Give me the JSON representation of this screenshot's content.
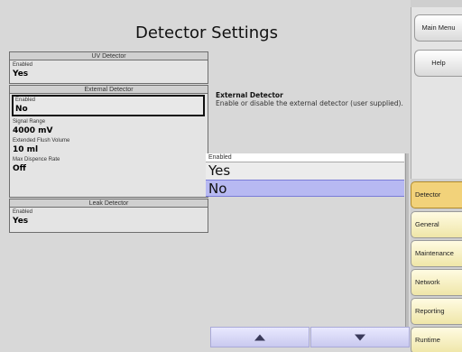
{
  "page": {
    "title": "Detector Settings"
  },
  "panels": {
    "uv": {
      "header": "UV Detector",
      "fields": [
        {
          "label": "Enabled",
          "value": "Yes"
        }
      ]
    },
    "external": {
      "header": "External Detector",
      "fields": [
        {
          "label": "Enabled",
          "value": "No"
        },
        {
          "label": "Signal Range",
          "value": "4000 mV"
        },
        {
          "label": "Extended Flush Volume",
          "value": "10 ml"
        },
        {
          "label": "Max Dispence Rate",
          "value": "Off"
        }
      ]
    },
    "leak": {
      "header": "Leak Detector",
      "fields": [
        {
          "label": "Enabled",
          "value": "Yes"
        }
      ]
    }
  },
  "help": {
    "title": "External Detector",
    "description": "Enable or disable the external detector (user supplied)."
  },
  "picker": {
    "label": "Enabled",
    "options": [
      "Yes",
      "No"
    ],
    "selected": "No"
  },
  "side": {
    "main_menu": "Main Menu",
    "help": "Help"
  },
  "tabs": [
    {
      "label": "Detector",
      "active": true
    },
    {
      "label": "General",
      "active": false
    },
    {
      "label": "Maintenance",
      "active": false
    },
    {
      "label": "Network",
      "active": false
    },
    {
      "label": "Reporting",
      "active": false
    },
    {
      "label": "Runtime",
      "active": false
    }
  ],
  "colors": {
    "background": "#d8d8d8",
    "selected_option": "#b7b9f2",
    "active_tab": "#f2d27a",
    "tab": "#efe6a8"
  },
  "icons": {
    "scroll_up": "triangle-up-icon",
    "scroll_down": "triangle-down-icon"
  }
}
